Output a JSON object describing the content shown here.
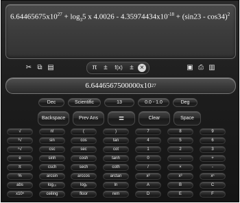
{
  "expression": {
    "text_html": "6.64465675x10<sup>27</sup> + log<sub>3</sub>5 x 4.0026 - 4.35974434x10<sup>-18</sup> + (sin23 - cos34)<sup>2</sup>"
  },
  "toolbar": {
    "left": [
      {
        "name": "scissors-icon",
        "glyph": "✂"
      },
      {
        "name": "copy-icon",
        "glyph": "⧉"
      },
      {
        "name": "paste-icon",
        "glyph": "▤"
      }
    ],
    "middle": [
      {
        "name": "pi-icon",
        "glyph": "π"
      },
      {
        "name": "plus-minus-icon",
        "glyph": "±"
      },
      {
        "name": "function-icon",
        "glyph": "f(x)"
      },
      {
        "name": "calc-symbols-icon",
        "glyph": "±"
      },
      {
        "name": "close-icon",
        "glyph": "✕"
      }
    ],
    "right": [
      {
        "name": "save-icon",
        "glyph": "▣"
      },
      {
        "name": "print-icon",
        "glyph": "⎙"
      },
      {
        "name": "open-icon",
        "glyph": "▥"
      }
    ]
  },
  "result": {
    "mantissa": "6.6446567500000x10",
    "exponent": "27"
  },
  "settings_row": [
    "Dec",
    "Scientific",
    "13",
    "0.0 - 1.0",
    "Deg"
  ],
  "action_row": [
    "Backspace",
    "Prev Ans",
    "=",
    "Clear",
    "Space"
  ],
  "keypad": [
    [
      "√",
      "n!",
      "(",
      ")",
      "7",
      "8",
      "9"
    ],
    [
      "³√",
      "sin",
      "cos",
      "tan",
      "4",
      "5",
      "6"
    ],
    [
      "ⁿ√",
      "csc",
      "sec",
      "cot",
      "1",
      "2",
      "3"
    ],
    [
      "e",
      "sinh",
      "cosh",
      "tanh",
      "0",
      ".",
      "+"
    ],
    [
      "π",
      "csch",
      "sech",
      "coth",
      "/",
      "×",
      "-"
    ],
    [
      "%",
      "arcsin",
      "arccos",
      "arctan",
      "x²",
      "x³",
      "xⁿ"
    ],
    [
      "abs",
      "log₁₀",
      "logₓ",
      "ln",
      "A",
      "B",
      "C"
    ],
    [
      "x10ⁿ",
      "ceiling",
      "floor",
      "rem",
      "D",
      "E",
      "F"
    ]
  ]
}
